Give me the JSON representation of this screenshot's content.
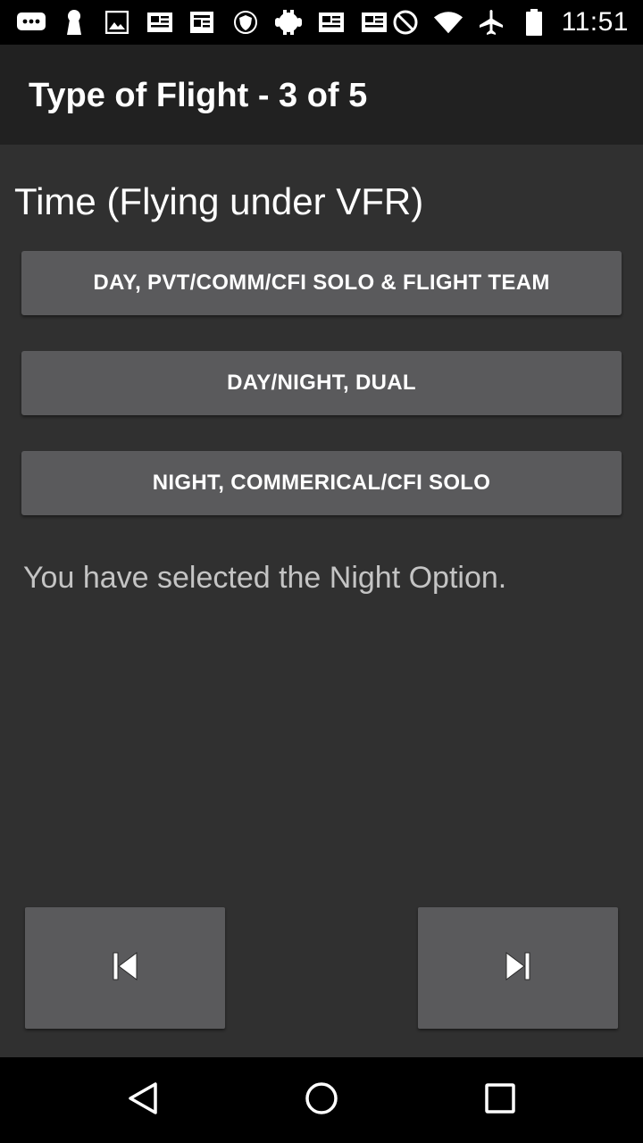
{
  "status_bar": {
    "time": "11:51",
    "left_icons": [
      "messaging-icon",
      "keyhole-icon",
      "image-icon",
      "news-icon",
      "news-icon",
      "shield-icon",
      "android-icon",
      "news-icon",
      "news-icon"
    ],
    "right_icons": [
      "do-not-disturb-icon",
      "wifi-icon",
      "airplane-icon",
      "battery-icon"
    ]
  },
  "app_bar": {
    "title": "Type of Flight - 3 of 5"
  },
  "section": {
    "title": "Time (Flying under VFR)"
  },
  "options": [
    {
      "label": "DAY, PVT/COMM/CFI SOLO & FLIGHT TEAM"
    },
    {
      "label": "DAY/NIGHT, DUAL"
    },
    {
      "label": "NIGHT, COMMERICAL/CFI SOLO"
    }
  ],
  "selection_message": "You have selected the Night Option.",
  "navigation": {
    "prev_icon": "skip-previous-icon",
    "next_icon": "skip-next-icon"
  },
  "system_nav": {
    "back_icon": "back-icon",
    "home_icon": "home-icon",
    "recents_icon": "recents-icon"
  },
  "colors": {
    "background": "#303030",
    "app_bar": "#212121",
    "button": "#5a5a5c",
    "text": "#ffffff",
    "message_text": "#c4c4c4"
  }
}
